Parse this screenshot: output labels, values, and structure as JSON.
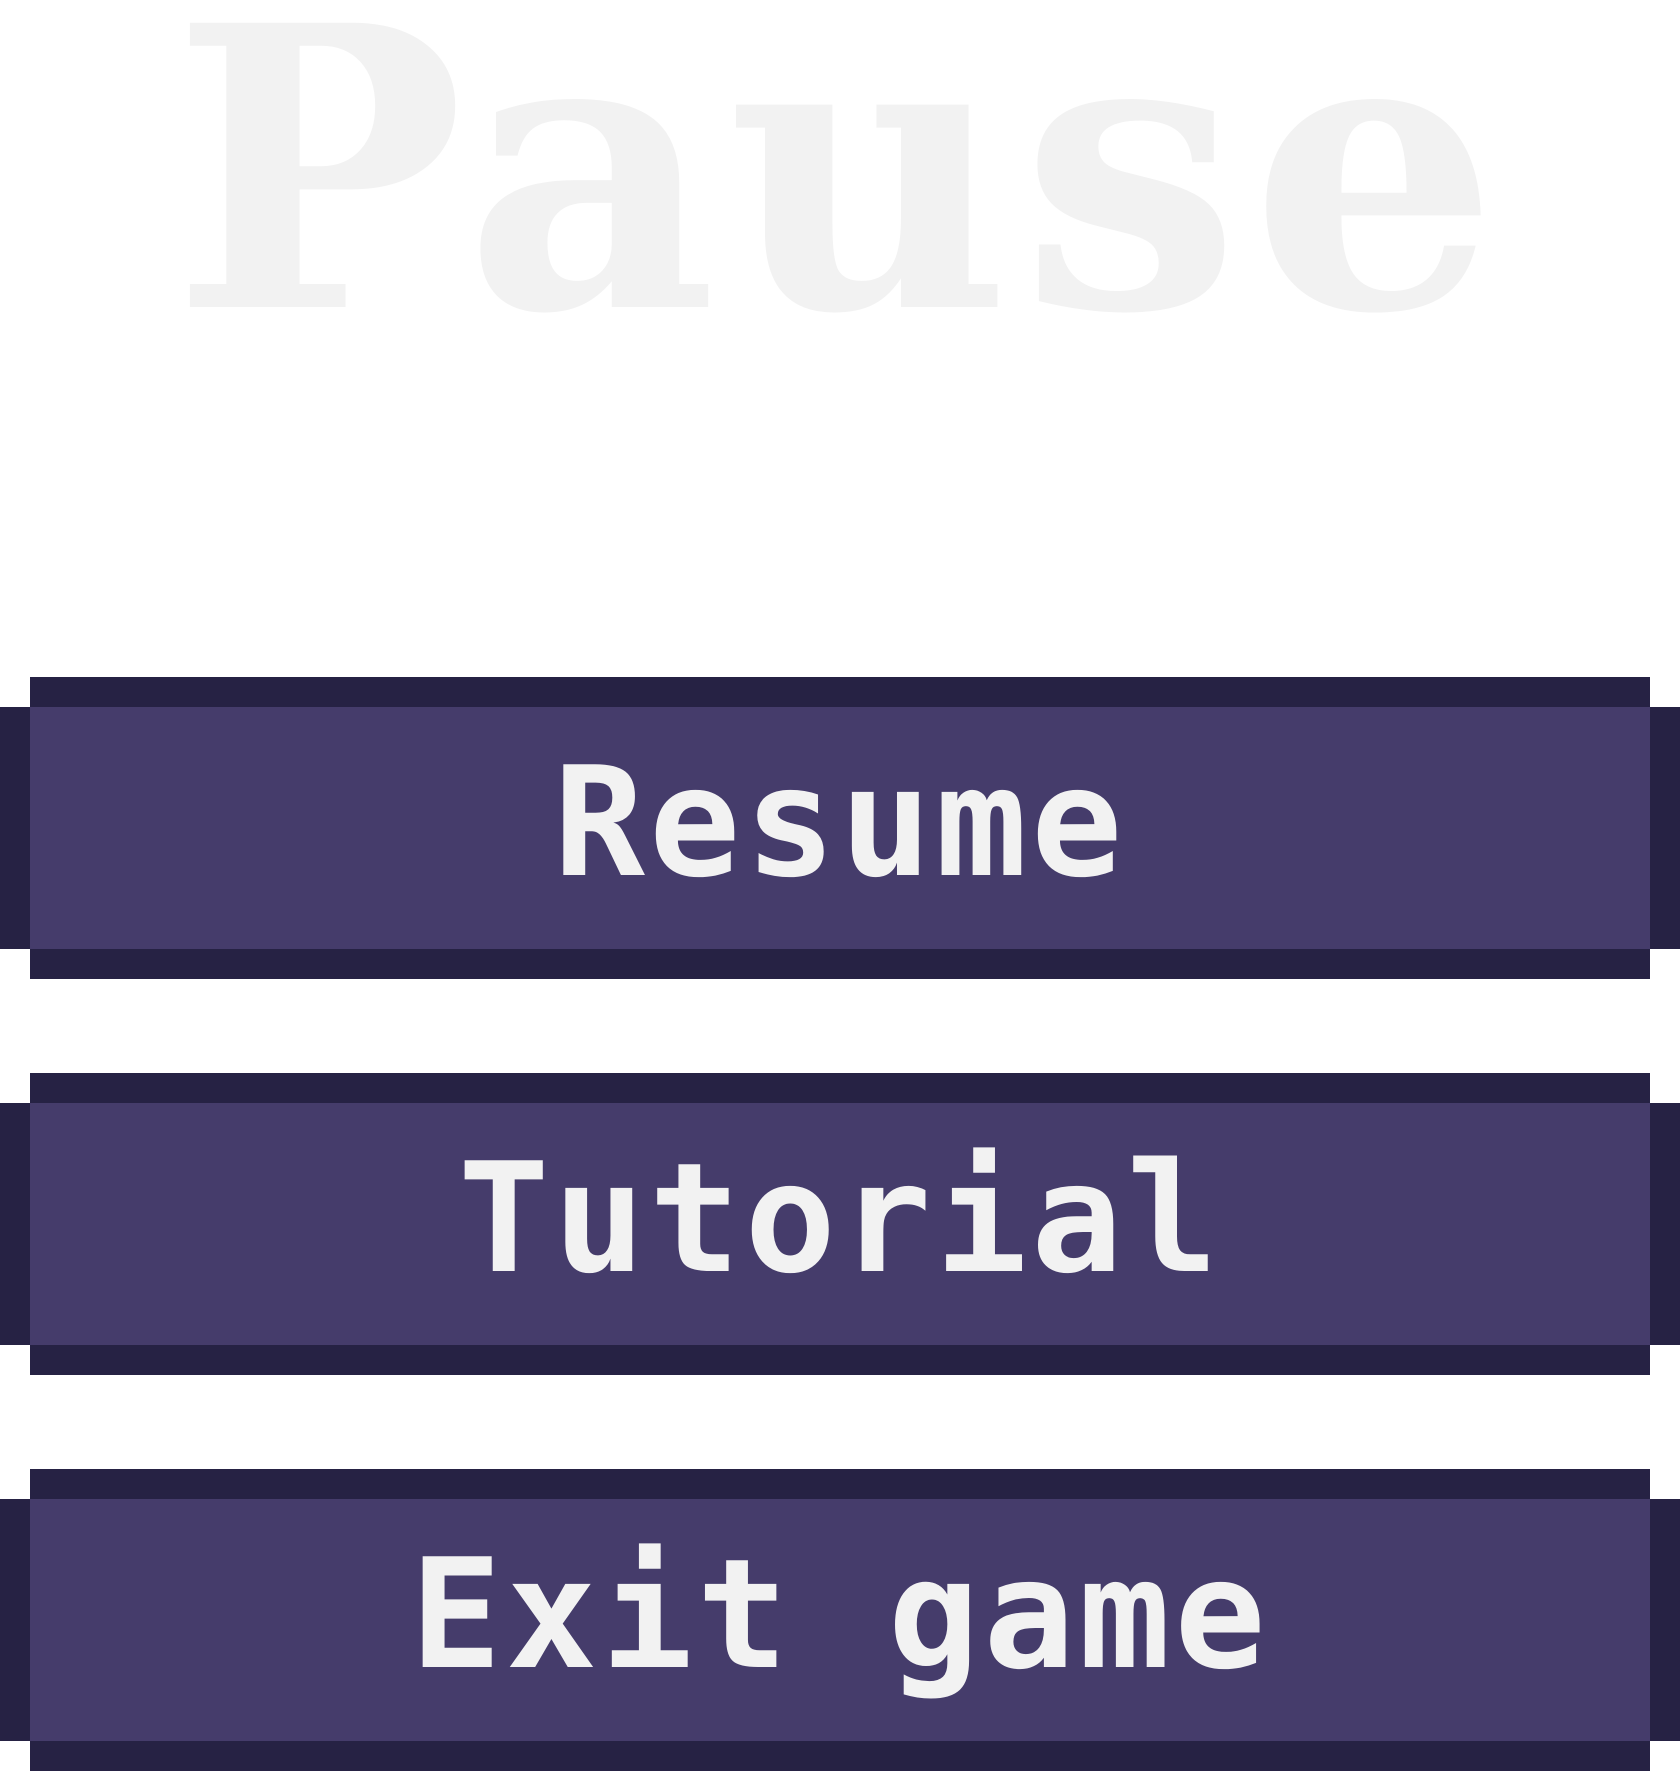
{
  "pause_menu": {
    "title": "Pause",
    "buttons": [
      {
        "label": "Resume"
      },
      {
        "label": "Tutorial"
      },
      {
        "label": "Exit game"
      }
    ]
  },
  "colors": {
    "title_text": "#f2f2f2",
    "button_face": "#453c6b",
    "button_border": "#262244",
    "button_text": "#f2f2f2",
    "background": "#ffffff"
  }
}
